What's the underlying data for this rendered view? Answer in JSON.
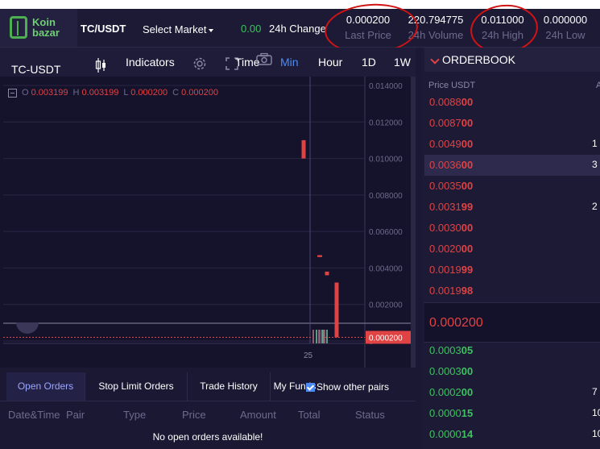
{
  "header": {
    "logo_line1": "Koin",
    "logo_line2": "bazar",
    "pair": "TC/USDT",
    "select_market": "Select Market",
    "change_value": "0.00",
    "change_label": "24h Change",
    "last_price": {
      "value": "0.000200",
      "label": "Last Price"
    },
    "volume": {
      "value": "220.794775",
      "label": "24h Volume"
    },
    "high": {
      "value": "0.011000",
      "label": "24h High"
    },
    "low": {
      "value": "0.000000",
      "label": "24h Low"
    }
  },
  "chart_toolbar": {
    "symbol": "TC-USDT",
    "indicators": "Indicators",
    "time_label": "Time",
    "intervals": [
      "Min",
      "Hour",
      "1D",
      "1W"
    ],
    "active_interval": "Min"
  },
  "ohlc_legend": {
    "o_label": "O",
    "o": "0.003199",
    "h_label": "H",
    "h": "0.003199",
    "l_label": "L",
    "l": "0.000200",
    "c_label": "C",
    "c": "0.000200"
  },
  "chart_data": {
    "type": "candlestick",
    "y_ticks": [
      "0.014000",
      "0.012000",
      "0.010000",
      "0.008000",
      "0.006000",
      "0.004000",
      "0.002000",
      "0"
    ],
    "ylim": [
      0,
      0.014
    ],
    "x_tick": "25",
    "current_price_label": "0.000200",
    "candles": [
      {
        "open": 0.011,
        "close": 0.01,
        "high": 0.011,
        "low": 0.01
      },
      {
        "open": 0.0047,
        "close": 0.0046,
        "high": 0.0047,
        "low": 0.0046
      },
      {
        "open": 0.0038,
        "close": 0.0036,
        "high": 0.0038,
        "low": 0.0036
      },
      {
        "open": 0.0032,
        "close": 0.0002,
        "high": 0.0032,
        "low": 0.0002
      }
    ],
    "colors": {
      "down": "#e04343",
      "grid": "#2a2745",
      "axis_text": "#6e6a8c",
      "price_line": "#e04343"
    }
  },
  "orders": {
    "tabs": [
      "Open Orders",
      "Stop Limit Orders",
      "Trade History",
      "My Funds"
    ],
    "active_tab": "Open Orders",
    "show_other_pairs": "Show other pairs",
    "columns": [
      "Date&Time",
      "Pair",
      "Type",
      "Price",
      "Amount",
      "Total",
      "Status"
    ],
    "empty_message": "No open orders available!"
  },
  "orderbook": {
    "title": "ORDERBOOK",
    "price_header": "Price USDT",
    "amount_header": "A",
    "sells": [
      {
        "p1": "0.0088",
        "p2": "00",
        "amount": ""
      },
      {
        "p1": "0.0087",
        "p2": "00",
        "amount": ""
      },
      {
        "p1": "0.0049",
        "p2": "00",
        "amount": "1"
      },
      {
        "p1": "0.0036",
        "p2": "00",
        "amount": "3"
      },
      {
        "p1": "0.0035",
        "p2": "00",
        "amount": ""
      },
      {
        "p1": "0.0031",
        "p2": "99",
        "amount": "2"
      },
      {
        "p1": "0.0030",
        "p2": "00",
        "amount": ""
      },
      {
        "p1": "0.0020",
        "p2": "00",
        "amount": ""
      },
      {
        "p1": "0.0019",
        "p2": "99",
        "amount": ""
      },
      {
        "p1": "0.0019",
        "p2": "98",
        "amount": ""
      }
    ],
    "last_price": "0.000200",
    "buys": [
      {
        "p1": "0.0003",
        "p2": "05",
        "amount": ""
      },
      {
        "p1": "0.0003",
        "p2": "00",
        "amount": ""
      },
      {
        "p1": "0.0002",
        "p2": "00",
        "amount": "7"
      },
      {
        "p1": "0.0000",
        "p2": "15",
        "amount": "10"
      },
      {
        "p1": "0.0000",
        "p2": "14",
        "amount": "10"
      }
    ]
  }
}
